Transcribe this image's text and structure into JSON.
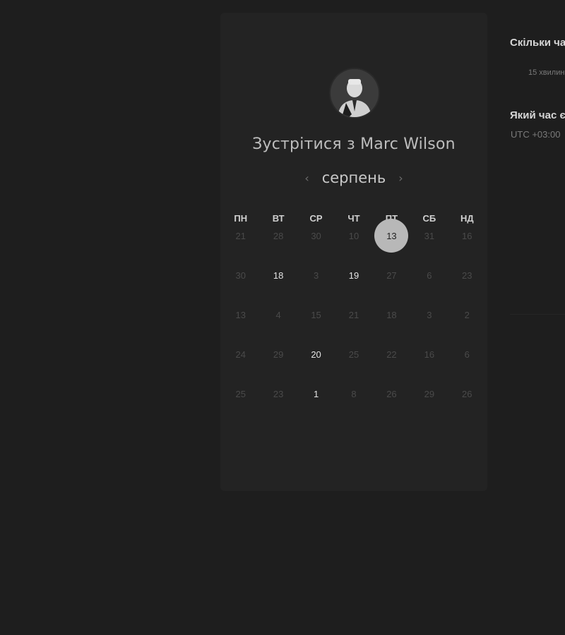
{
  "host": {
    "title_prefix": "Зустрітися з",
    "name": "Marc Wilson"
  },
  "calendar": {
    "month": "серпень",
    "prev_icon": "chevron-left-icon",
    "next_icon": "chevron-right-icon",
    "weekdays": [
      "ПН",
      "ВТ",
      "СР",
      "ЧТ",
      "ПТ",
      "СБ",
      "НД"
    ],
    "weeks": [
      [
        {
          "label": "21",
          "available": false
        },
        {
          "label": "28",
          "available": false
        },
        {
          "label": "30",
          "available": false
        },
        {
          "label": "10",
          "available": false
        },
        {
          "label": "13",
          "available": true,
          "selected": true
        },
        {
          "label": "31",
          "available": false
        },
        {
          "label": "16",
          "available": false
        }
      ],
      [
        {
          "label": "30",
          "available": false
        },
        {
          "label": "18",
          "available": true
        },
        {
          "label": "3",
          "available": false
        },
        {
          "label": "19",
          "available": true
        },
        {
          "label": "27",
          "available": false
        },
        {
          "label": "6",
          "available": false
        },
        {
          "label": "23",
          "available": false
        }
      ],
      [
        {
          "label": "13",
          "available": false
        },
        {
          "label": "4",
          "available": false
        },
        {
          "label": "15",
          "available": false
        },
        {
          "label": "21",
          "available": false
        },
        {
          "label": "18",
          "available": false
        },
        {
          "label": "3",
          "available": false
        },
        {
          "label": "2",
          "available": false
        }
      ],
      [
        {
          "label": "24",
          "available": false
        },
        {
          "label": "29",
          "available": false
        },
        {
          "label": "20",
          "available": true
        },
        {
          "label": "25",
          "available": false
        },
        {
          "label": "22",
          "available": false
        },
        {
          "label": "16",
          "available": false
        },
        {
          "label": "6",
          "available": false
        }
      ],
      [
        {
          "label": "25",
          "available": false
        },
        {
          "label": "23",
          "available": false
        },
        {
          "label": "1",
          "available": true
        },
        {
          "label": "8",
          "available": false
        },
        {
          "label": "26",
          "available": false
        },
        {
          "label": "29",
          "available": false
        },
        {
          "label": "26",
          "available": false
        }
      ]
    ]
  },
  "side_panel": {
    "question_duration": "Скільки ча",
    "duration_value": "15 хвилин",
    "question_timezone": "Який час є",
    "timezone_value": "UTC +03:00"
  },
  "colors": {
    "background": "#1e1e1e",
    "card": "#232323",
    "selected_day": "#b8b8b8"
  }
}
